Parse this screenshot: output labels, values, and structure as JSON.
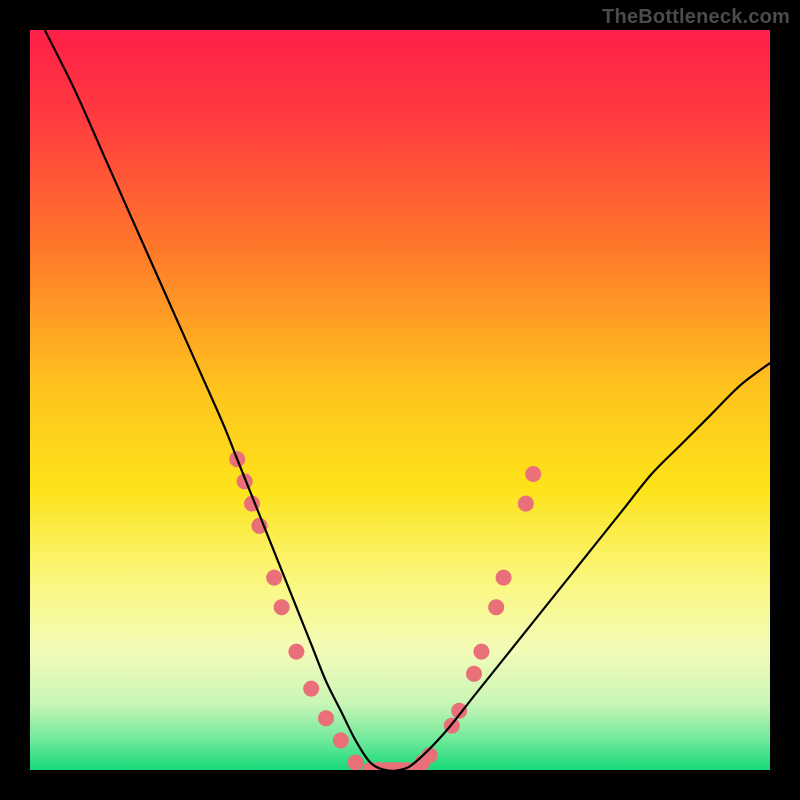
{
  "watermark": "TheBottleneck.com",
  "chart_data": {
    "type": "line",
    "title": "",
    "xlabel": "",
    "ylabel": "",
    "xlim": [
      0,
      100
    ],
    "ylim": [
      0,
      100
    ],
    "background_gradient": {
      "stops": [
        {
          "offset": 0.0,
          "color": "#ff1f49"
        },
        {
          "offset": 0.12,
          "color": "#ff3b3f"
        },
        {
          "offset": 0.3,
          "color": "#ff7a2a"
        },
        {
          "offset": 0.48,
          "color": "#ffc21e"
        },
        {
          "offset": 0.62,
          "color": "#fde31a"
        },
        {
          "offset": 0.74,
          "color": "#fbf77c"
        },
        {
          "offset": 0.84,
          "color": "#f3fbb8"
        },
        {
          "offset": 0.91,
          "color": "#c9f6b6"
        },
        {
          "offset": 0.96,
          "color": "#6de99a"
        },
        {
          "offset": 1.0,
          "color": "#17d979"
        }
      ]
    },
    "series": [
      {
        "name": "bottleneck-curve",
        "color": "#000000",
        "x": [
          2,
          6,
          10,
          14,
          18,
          22,
          26,
          28,
          30,
          32,
          34,
          36,
          38,
          40,
          42,
          44,
          46,
          48,
          50,
          52,
          56,
          60,
          64,
          68,
          72,
          76,
          80,
          84,
          88,
          92,
          96,
          100
        ],
        "y": [
          100,
          92,
          83,
          74,
          65,
          56,
          47,
          42,
          37,
          32,
          27,
          22,
          17,
          12,
          8,
          4,
          1,
          0,
          0,
          1,
          5,
          10,
          15,
          20,
          25,
          30,
          35,
          40,
          44,
          48,
          52,
          55
        ]
      }
    ],
    "points": {
      "name": "sample-dots",
      "color": "#e96f78",
      "radius": 8,
      "data": [
        {
          "x": 28,
          "y": 42
        },
        {
          "x": 29,
          "y": 39
        },
        {
          "x": 30,
          "y": 36
        },
        {
          "x": 31,
          "y": 33
        },
        {
          "x": 33,
          "y": 26
        },
        {
          "x": 34,
          "y": 22
        },
        {
          "x": 36,
          "y": 16
        },
        {
          "x": 38,
          "y": 11
        },
        {
          "x": 40,
          "y": 7
        },
        {
          "x": 42,
          "y": 4
        },
        {
          "x": 44,
          "y": 1
        },
        {
          "x": 46,
          "y": 0
        },
        {
          "x": 47,
          "y": 0
        },
        {
          "x": 48,
          "y": 0
        },
        {
          "x": 49,
          "y": 0
        },
        {
          "x": 50,
          "y": 0
        },
        {
          "x": 51,
          "y": 0
        },
        {
          "x": 52,
          "y": 0
        },
        {
          "x": 53,
          "y": 1
        },
        {
          "x": 54,
          "y": 2
        },
        {
          "x": 57,
          "y": 6
        },
        {
          "x": 58,
          "y": 8
        },
        {
          "x": 60,
          "y": 13
        },
        {
          "x": 61,
          "y": 16
        },
        {
          "x": 63,
          "y": 22
        },
        {
          "x": 64,
          "y": 26
        },
        {
          "x": 67,
          "y": 36
        },
        {
          "x": 68,
          "y": 40
        }
      ]
    }
  }
}
